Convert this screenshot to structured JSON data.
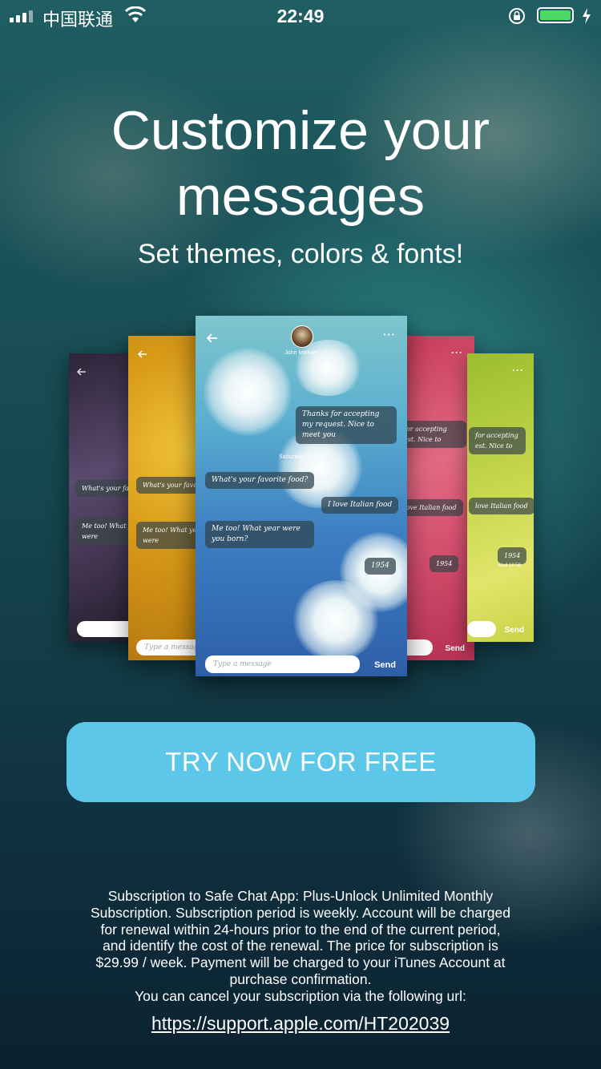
{
  "status_bar": {
    "carrier": "中国联通",
    "time": "22:49",
    "battery_level": 1.0,
    "icons": [
      "signal-icon",
      "wifi-icon",
      "rotation-lock-icon",
      "battery-icon",
      "charging-icon"
    ]
  },
  "header": {
    "title": "Customize your messages",
    "subtitle": "Set themes, colors & fonts!"
  },
  "preview": {
    "contact_name": "John Michael",
    "day_label": "Saturday 20:21",
    "messages": [
      {
        "text": "Thanks for accepting my request. Nice to meet you"
      },
      {
        "text": "What's your favorite food?"
      },
      {
        "text": "I love Italian food"
      },
      {
        "text": "Me too! What year were you born?"
      },
      {
        "text": "1954"
      }
    ],
    "side_cards": {
      "purple": {
        "msg1": "What's your fav",
        "msg2": "Me too! What year were"
      },
      "yellow": {
        "msg1": "What's your favo",
        "msg2": "Me too! What year were",
        "input_placeholder": "Type a messag"
      },
      "pink": {
        "msg1": "for accepting est. Nice to",
        "msg2": "love Italian food",
        "msg3": "1954",
        "send": "Send"
      },
      "green": {
        "msg1": "for accepting est. Nice to",
        "msg2": "love Italian food",
        "msg3": "1954",
        "time": "Wed 18:58",
        "send": "Send"
      }
    },
    "input_placeholder": "Type a message",
    "send_label": "Send"
  },
  "cta": {
    "label": "TRY NOW FOR FREE",
    "color": "#5dc7ea"
  },
  "legal": {
    "lines": [
      "Subscription to Safe Chat App: Plus-Unlock Unlimited Monthly",
      "Subscription. Subscription period is weekly. Account will be charged",
      "for renewal within 24-hours prior to the end of the current period,",
      "and identify the cost of the renewal. The price for subscription is",
      "$29.99 / week. Payment will be charged to your iTunes Account at",
      "purchase confirmation.",
      "You can cancel your subscription via the following url:"
    ],
    "url": "https://support.apple.com/HT202039"
  }
}
